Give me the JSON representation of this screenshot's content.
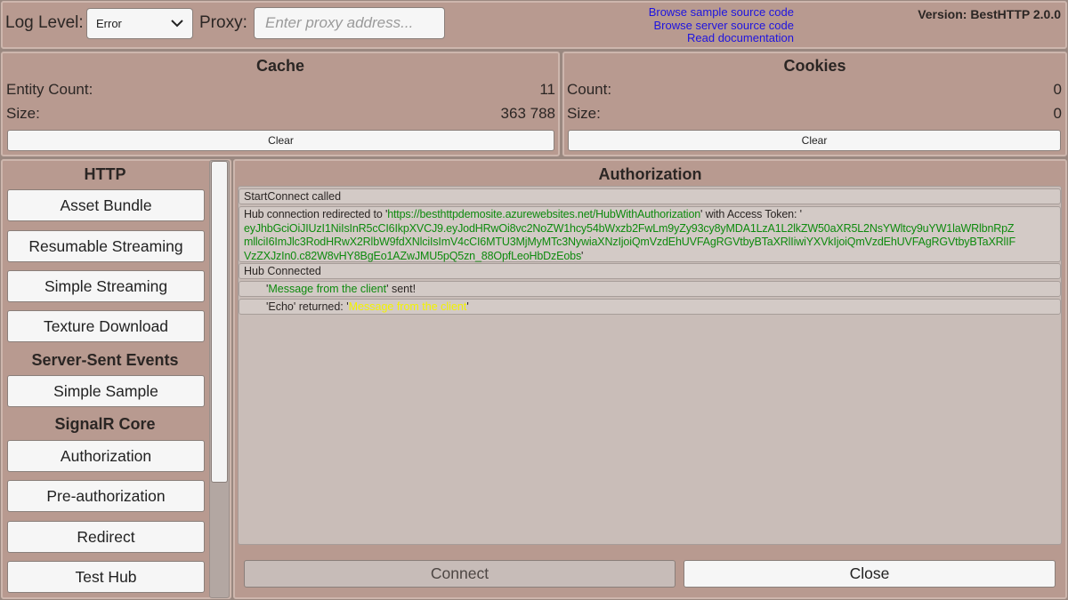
{
  "toolbar": {
    "log_level_label": "Log Level:",
    "log_level_value": "Error",
    "proxy_label": "Proxy:",
    "proxy_placeholder": "Enter proxy address...",
    "links": [
      "Browse sample source code",
      "Browse server source code",
      "Read documentation"
    ],
    "version": "Version: BestHTTP 2.0.0"
  },
  "cache": {
    "title": "Cache",
    "entity_count_label": "Entity Count:",
    "entity_count_value": "11",
    "size_label": "Size:",
    "size_value": "363 788",
    "clear_label": "Clear"
  },
  "cookies": {
    "title": "Cookies",
    "count_label": "Count:",
    "count_value": "0",
    "size_label": "Size:",
    "size_value": "0",
    "clear_label": "Clear"
  },
  "sidebar": {
    "http_header": "HTTP",
    "http_items": [
      "Asset Bundle",
      "Resumable Streaming",
      "Simple Streaming",
      "Texture Download"
    ],
    "sse_header": "Server-Sent Events",
    "sse_items": [
      "Simple Sample"
    ],
    "signalr_header": "SignalR Core",
    "signalr_items": [
      "Authorization",
      "Pre-authorization",
      "Redirect",
      "Test Hub"
    ]
  },
  "main": {
    "title": "Authorization",
    "log": {
      "start_connect": "StartConnect called",
      "redirect_prefix": "Hub connection redirected to '",
      "redirect_url": "https://besthttpdemosite.azurewebsites.net/HubWithAuthorization",
      "redirect_mid": "' with Access Token: '",
      "token_line1": "eyJhbGciOiJIUzI1NiIsInR5cCI6IkpXVCJ9.eyJodHRwOi8vc2NoZW1hcy54bWxzb2FwLm9yZy93cy8yMDA1LzA1L2lkZW50aXR5L2NsYWltcy9uYW1laWRlbnRpZ",
      "token_line2": "mllciI6ImJlc3RodHRwX2RlbW9fdXNlciIsImV4cCI6MTU3MjMyMTc3NywiaXNzIjoiQmVzdEhUVFAgRGVtbyBTaXRlIiwiYXVkIjoiQmVzdEhUVFAgRGVtbyBTaXRlIF",
      "token_line3": "VzZXJzIn0.c82W8vHY8BgEo1AZwJMU5pQ5zn_88OpfLeoHbDzEobs",
      "redirect_suffix": "'",
      "hub_connected": "Hub Connected",
      "quote": "'",
      "message": "Message from the client",
      "sent_suffix": "' sent!",
      "echo_prefix": "'Echo' returned: '",
      "echo_suffix": "'"
    },
    "connect_label": "Connect",
    "close_label": "Close"
  }
}
